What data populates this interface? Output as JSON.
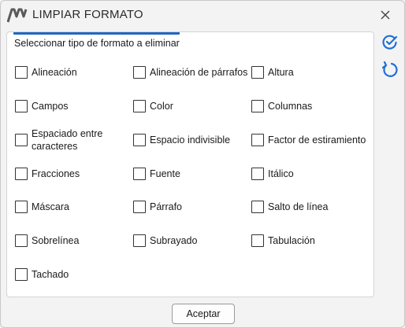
{
  "window": {
    "title": "LIMPIAR FORMATO"
  },
  "panel": {
    "heading": "Seleccionar tipo de formato a eliminar"
  },
  "options": [
    {
      "label": "Alineación",
      "checked": false
    },
    {
      "label": "Alineación de párrafos",
      "checked": false
    },
    {
      "label": "Altura",
      "checked": false
    },
    {
      "label": "Campos",
      "checked": false
    },
    {
      "label": "Color",
      "checked": false
    },
    {
      "label": "Columnas",
      "checked": false
    },
    {
      "label": "Espaciado entre caracteres",
      "checked": false
    },
    {
      "label": "Espacio indivisible",
      "checked": false
    },
    {
      "label": "Factor de estiramiento",
      "checked": false
    },
    {
      "label": "Fracciones",
      "checked": false
    },
    {
      "label": "Fuente",
      "checked": false
    },
    {
      "label": "Itálico",
      "checked": false
    },
    {
      "label": "Máscara",
      "checked": false
    },
    {
      "label": "Párrafo",
      "checked": false
    },
    {
      "label": "Salto de línea",
      "checked": false
    },
    {
      "label": "Sobrelínea",
      "checked": false
    },
    {
      "label": "Subrayado",
      "checked": false
    },
    {
      "label": "Tabulación",
      "checked": false
    },
    {
      "label": "Tachado",
      "checked": false
    }
  ],
  "footer": {
    "accept_label": "Aceptar"
  },
  "icons": {
    "app_logo": "app-logo-icon",
    "close": "close-icon",
    "select_all": "check-all-icon",
    "reset": "reset-icon"
  },
  "colors": {
    "accent": "#2166c4",
    "icon_blue": "#1f6fd6"
  }
}
